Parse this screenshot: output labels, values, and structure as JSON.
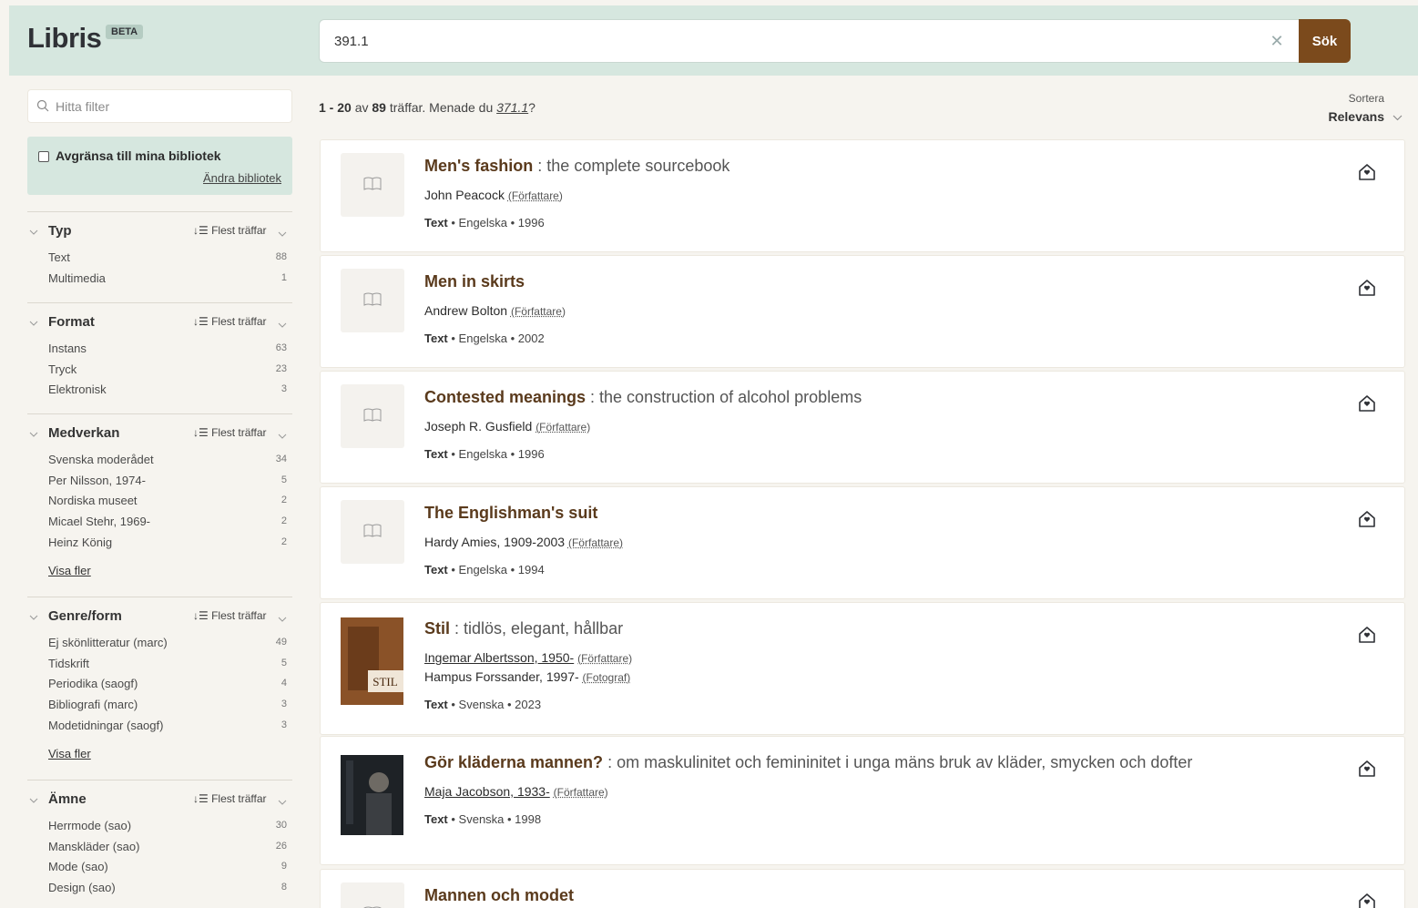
{
  "header": {
    "logo": "Libris",
    "beta_badge": "BETA",
    "search_value": "391.1",
    "search_button": "Sök",
    "colors": {
      "header_bg": "#d6e7df",
      "search_button_bg": "#7b4a1c"
    }
  },
  "sidebar": {
    "filter_placeholder": "Hitta filter",
    "library_limit_label": "Avgränsa till mina bibliotek",
    "change_libraries": "Ändra bibliotek",
    "facets": [
      {
        "title": "Typ",
        "sort": "Flest träffar",
        "items": [
          {
            "label": "Text",
            "count": "88"
          },
          {
            "label": "Multimedia",
            "count": "1"
          }
        ]
      },
      {
        "title": "Format",
        "sort": "Flest träffar",
        "items": [
          {
            "label": "Instans",
            "count": "63"
          },
          {
            "label": "Tryck",
            "count": "23"
          },
          {
            "label": "Elektronisk",
            "count": "3"
          }
        ]
      },
      {
        "title": "Medverkan",
        "sort": "Flest träffar",
        "items": [
          {
            "label": "Svenska moderådet",
            "count": "34"
          },
          {
            "label": "Per Nilsson, 1974-",
            "count": "5"
          },
          {
            "label": "Nordiska museet",
            "count": "2"
          },
          {
            "label": "Micael Stehr, 1969-",
            "count": "2"
          },
          {
            "label": "Heinz König",
            "count": "2"
          }
        ],
        "show_more": "Visa fler"
      },
      {
        "title": "Genre/form",
        "sort": "Flest träffar",
        "items": [
          {
            "label": "Ej skönlitteratur (marc)",
            "count": "49"
          },
          {
            "label": "Tidskrift",
            "count": "5"
          },
          {
            "label": "Periodika (saogf)",
            "count": "4"
          },
          {
            "label": "Bibliografi (marc)",
            "count": "3"
          },
          {
            "label": "Modetidningar (saogf)",
            "count": "3"
          }
        ],
        "show_more": "Visa fler"
      },
      {
        "title": "Ämne",
        "sort": "Flest träffar",
        "items": [
          {
            "label": "Herrmode (sao)",
            "count": "30"
          },
          {
            "label": "Manskläder (sao)",
            "count": "26"
          },
          {
            "label": "Mode (sao)",
            "count": "9"
          },
          {
            "label": "Design (sao)",
            "count": "8"
          }
        ]
      }
    ]
  },
  "results": {
    "range": "1 - 20",
    "of": "av",
    "total": "89",
    "hits_text": "träffar. Menade du",
    "suggestion": "371.1",
    "question": "?",
    "sort_label": "Sortera",
    "sort_value": "Relevans",
    "items": [
      {
        "title": "Men's fashion",
        "subtitle": " : the complete sourcebook",
        "contributors": [
          {
            "name": "John Peacock",
            "role": "(Författare)",
            "linked": false
          }
        ],
        "type": "Text",
        "details": " • Engelska • 1996",
        "cover": "none"
      },
      {
        "title": "Men in skirts",
        "subtitle": "",
        "contributors": [
          {
            "name": "Andrew Bolton",
            "role": "(Författare)",
            "linked": false
          }
        ],
        "type": "Text",
        "details": " • Engelska • 2002",
        "cover": "none"
      },
      {
        "title": "Contested meanings",
        "subtitle": " : the construction of alcohol problems",
        "contributors": [
          {
            "name": "Joseph R. Gusfield",
            "role": "(Författare)",
            "linked": false
          }
        ],
        "type": "Text",
        "details": " • Engelska • 1996",
        "cover": "none"
      },
      {
        "title": "The Englishman's suit",
        "subtitle": "",
        "contributors": [
          {
            "name": "Hardy Amies, 1909-2003",
            "role": "(Författare)",
            "linked": false
          }
        ],
        "type": "Text",
        "details": " • Engelska • 1994",
        "cover": "none"
      },
      {
        "title": "Stil",
        "subtitle": " : tidlös, elegant, hållbar",
        "contributors": [
          {
            "name": "Ingemar Albertsson, 1950-",
            "role": "(Författare)",
            "linked": true
          },
          {
            "name": "Hampus Forssander, 1997-",
            "role": "(Fotograf)",
            "linked": false
          }
        ],
        "type": "Text",
        "details": " • Svenska • 2023",
        "cover": "stil",
        "cover_text": "STIL"
      },
      {
        "title": "Gör kläderna mannen?",
        "subtitle": " : om maskulinitet och femininitet i unga mäns bruk av kläder, smycken och dofter",
        "contributors": [
          {
            "name": "Maja Jacobson, 1933-",
            "role": "(Författare)",
            "linked": true
          }
        ],
        "type": "Text",
        "details": " • Svenska • 1998",
        "cover": "photo"
      },
      {
        "title": "Mannen och modet",
        "subtitle": "",
        "contributors": [],
        "type": "",
        "details": "",
        "cover": "none"
      }
    ]
  }
}
